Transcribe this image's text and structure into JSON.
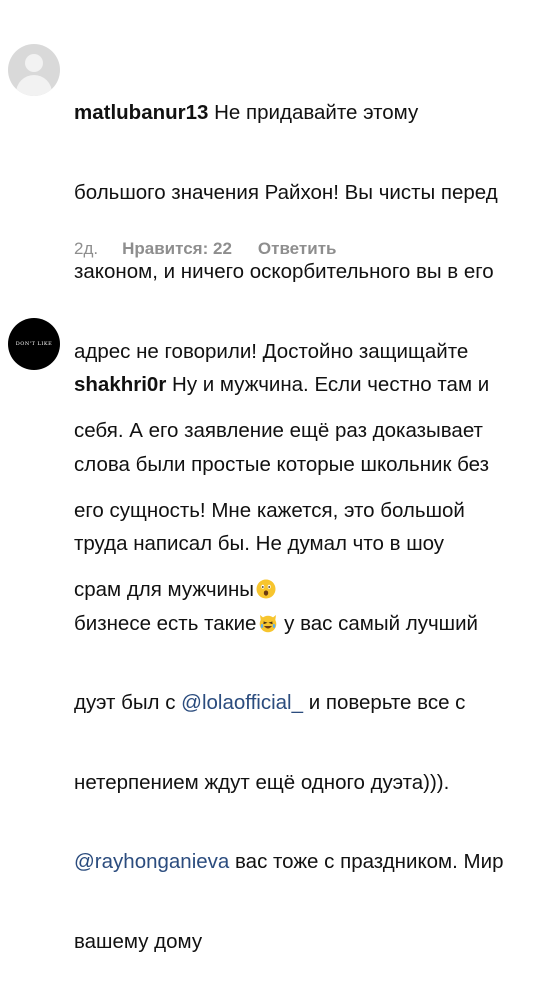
{
  "comments": [
    {
      "username": "matlubanur13",
      "lines": [
        "Не придавайте этому",
        "большого значения Райхон! Вы чисты перед",
        "законом, и ничего оскорбительного вы в его",
        "адрес не говорили! Достойно защищайте",
        "себя. А его заявление ещё раз доказывает",
        "его сущность! Мне кажется, это большой",
        "срам для мужчины"
      ],
      "time": "2д.",
      "likes_label": "Нравится: 22",
      "reply_label": "Ответить",
      "emoji": "astonished-face"
    },
    {
      "username": "shakhri0r",
      "avatar_logo_text": "DON'T LIKE",
      "lines": [
        "Ну и мужчина. Если честно там и",
        "слова были простые которые школьник без",
        "труда написал бы. Не думал что в шоу",
        "бизнесе есть такие",
        " у вас самый лучший",
        "дуэт был с ",
        "@lolaofficial_",
        " и поверьте все с",
        "нетерпением ждут ещё одного дуэта))).",
        "@rayhonganieva",
        " вас тоже с праздником. Мир",
        "вашему дому"
      ],
      "emoji": "crying-laughing-cat"
    }
  ],
  "colors": {
    "text": "#111111",
    "meta": "#8e8e8e",
    "mention": "#2b4c7e"
  }
}
